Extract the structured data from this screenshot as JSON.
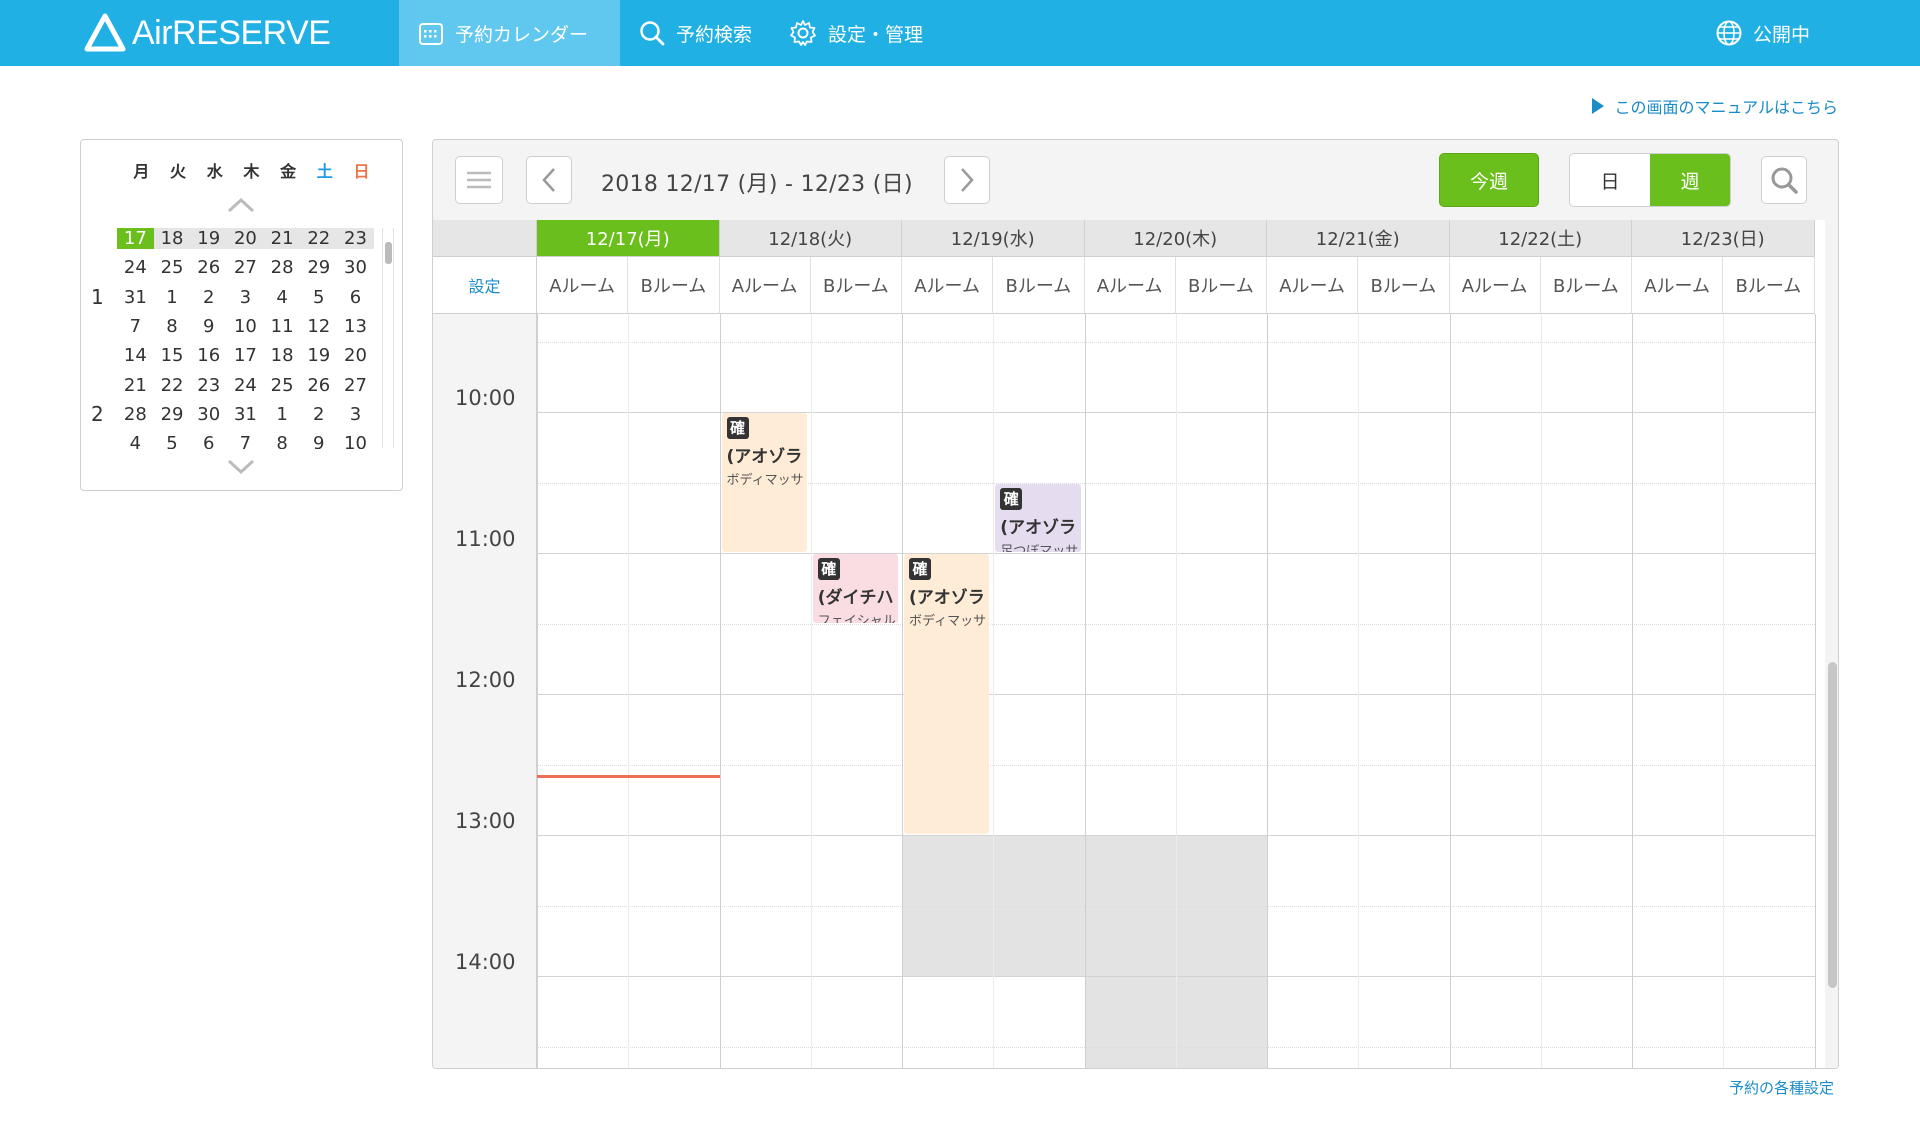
{
  "app": {
    "logo": "AirRESERVE",
    "brand_color": "#20b0e3",
    "accent": "#6bbf1c"
  },
  "nav": [
    {
      "label": "予約カレンダー",
      "icon": "calendar-icon",
      "active": true
    },
    {
      "label": "予約検索",
      "icon": "search-icon",
      "active": false
    },
    {
      "label": "設定・管理",
      "icon": "gear-icon",
      "active": false
    }
  ],
  "publish_status": "公開中",
  "manual_link": "この画面のマニュアルはこちら",
  "mini_calendar": {
    "weekdays": [
      "月",
      "火",
      "水",
      "木",
      "金",
      "土",
      "日"
    ],
    "weeks": [
      {
        "month": "",
        "days": [
          "17",
          "18",
          "19",
          "20",
          "21",
          "22",
          "23"
        ],
        "current": true,
        "today_index": 0
      },
      {
        "month": "",
        "days": [
          "24",
          "25",
          "26",
          "27",
          "28",
          "29",
          "30"
        ]
      },
      {
        "month": "1",
        "days": [
          "31",
          "1",
          "2",
          "3",
          "4",
          "5",
          "6"
        ]
      },
      {
        "month": "",
        "days": [
          "7",
          "8",
          "9",
          "10",
          "11",
          "12",
          "13"
        ]
      },
      {
        "month": "",
        "days": [
          "14",
          "15",
          "16",
          "17",
          "18",
          "19",
          "20"
        ]
      },
      {
        "month": "",
        "days": [
          "21",
          "22",
          "23",
          "24",
          "25",
          "26",
          "27"
        ]
      },
      {
        "month": "2",
        "days": [
          "28",
          "29",
          "30",
          "31",
          "1",
          "2",
          "3"
        ]
      },
      {
        "month": "",
        "days": [
          "4",
          "5",
          "6",
          "7",
          "8",
          "9",
          "10"
        ]
      }
    ]
  },
  "toolbar": {
    "range": "2018 12/17 (月) - 12/23 (日)",
    "this_week": "今週",
    "view_day": "日",
    "view_week": "週",
    "selected_view": "週"
  },
  "calendar": {
    "settings_label": "設定",
    "days": [
      {
        "label": "12/17(月)",
        "today": true
      },
      {
        "label": "12/18(火)"
      },
      {
        "label": "12/19(水)"
      },
      {
        "label": "12/20(木)"
      },
      {
        "label": "12/21(金)"
      },
      {
        "label": "12/22(土)"
      },
      {
        "label": "12/23(日)"
      }
    ],
    "rooms": [
      "Aルーム",
      "Bルーム"
    ],
    "times": [
      "10:00",
      "11:00",
      "12:00",
      "13:00",
      "14:00"
    ],
    "events": [
      {
        "day": 1,
        "room": 0,
        "start": "10:00",
        "end": "11:00",
        "badge": "確",
        "name": "(アオゾラ",
        "menu": "ボディマッサ",
        "color": "orange"
      },
      {
        "day": 2,
        "room": 1,
        "start": "10:30",
        "end": "11:00",
        "badge": "確",
        "name": "(アオゾラ",
        "menu": "足つぼマッサ",
        "color": "purple"
      },
      {
        "day": 1,
        "room": 1,
        "start": "11:00",
        "end": "11:30",
        "badge": "確",
        "name": "(ダイチハ",
        "menu": "フェイシャル",
        "color": "pink"
      },
      {
        "day": 2,
        "room": 0,
        "start": "11:00",
        "end": "13:00",
        "badge": "確",
        "name": "(アオゾラ",
        "menu": "ボディマッサ",
        "color": "orange"
      }
    ],
    "current_time": "12:35"
  },
  "footer_link": "予約の各種設定"
}
